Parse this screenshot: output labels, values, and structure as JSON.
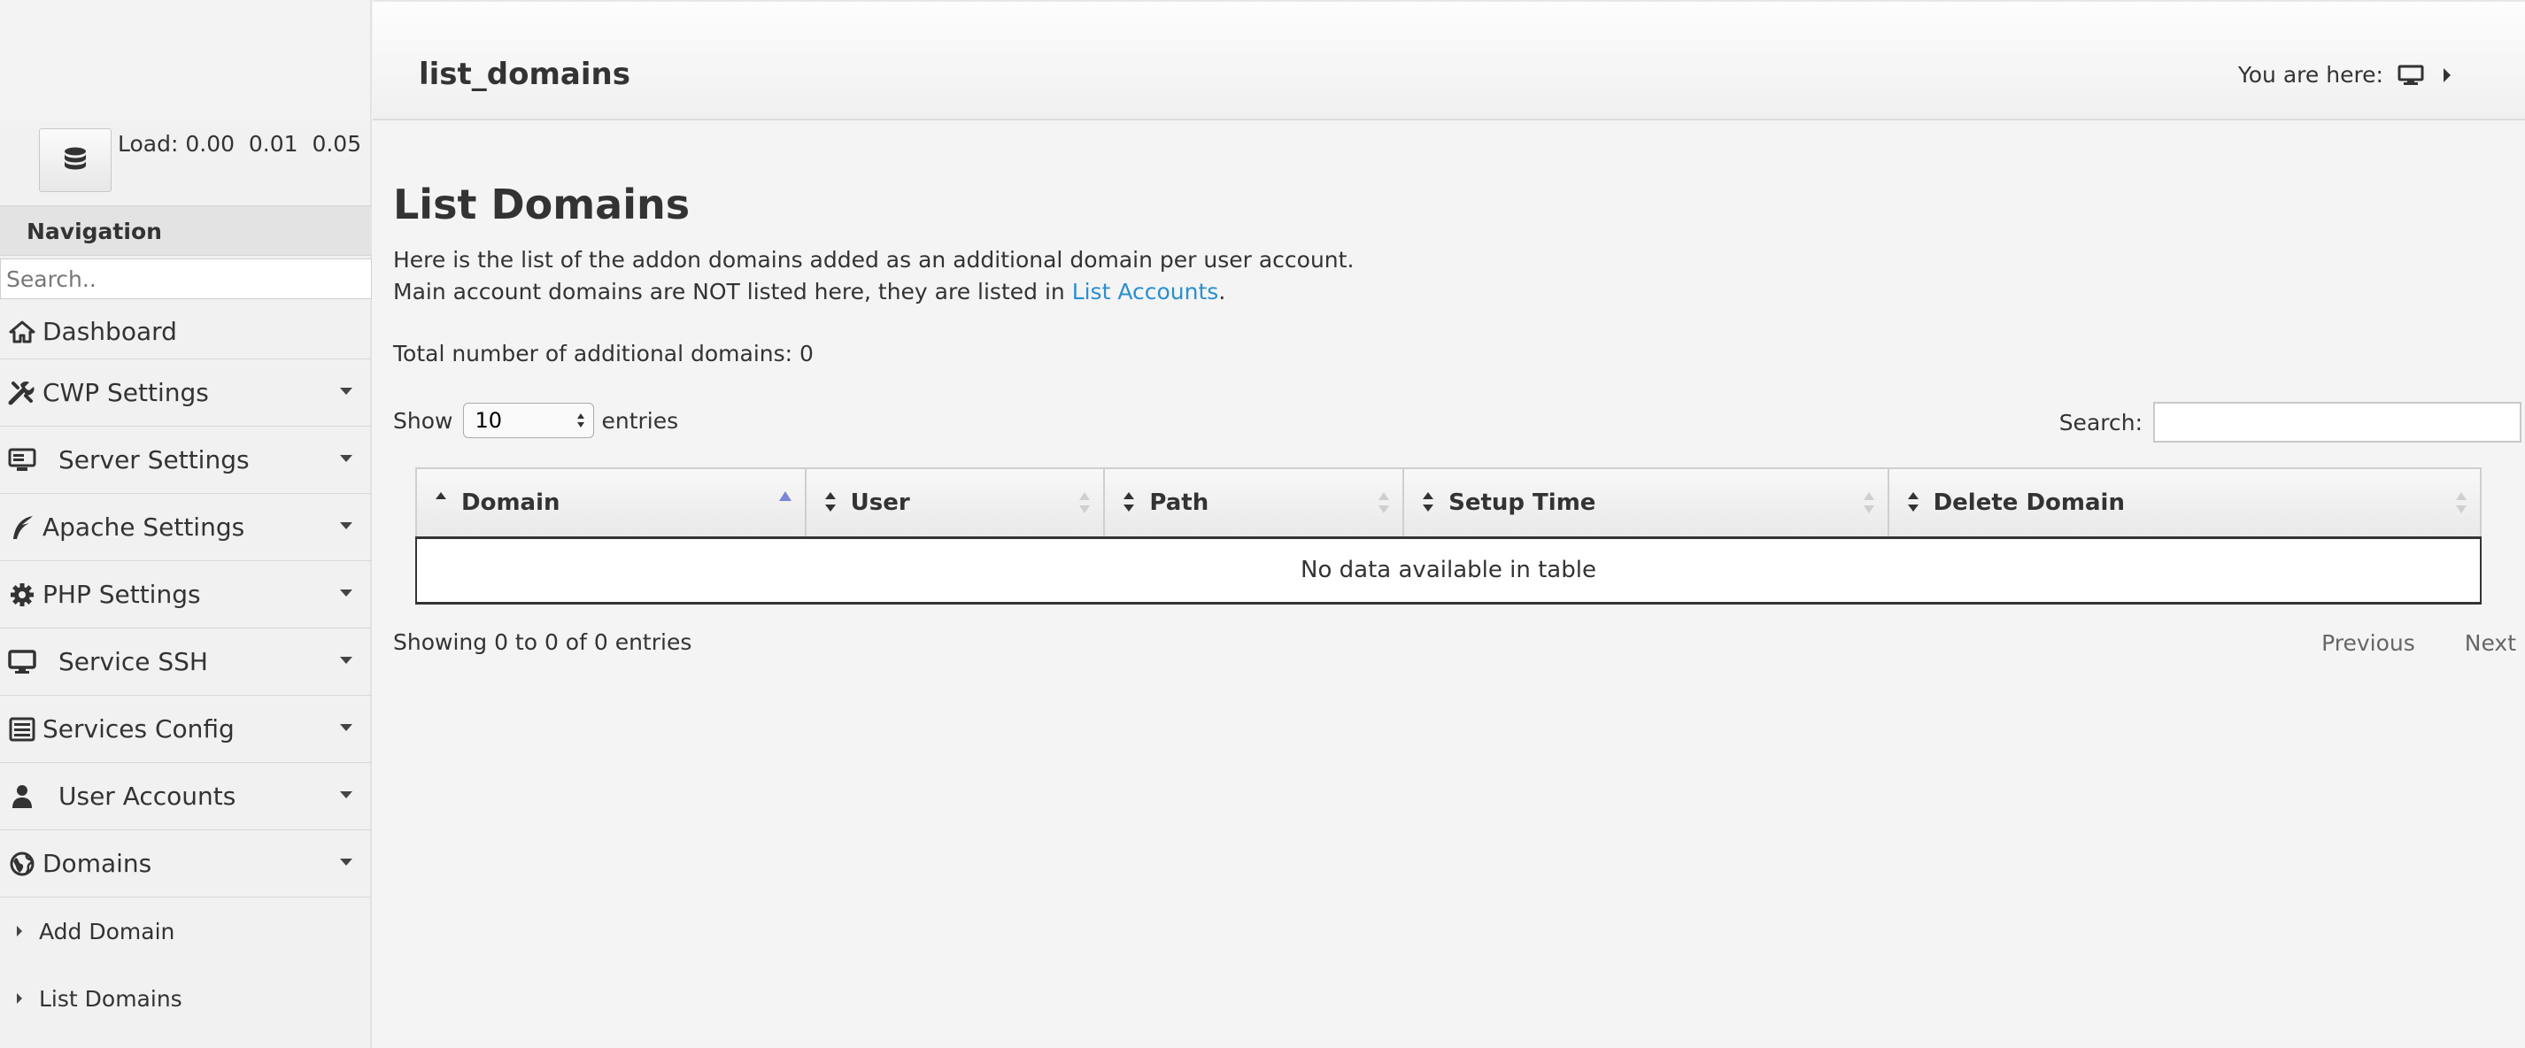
{
  "sidebar": {
    "load_label": "Load: 0.00  0.01  0.05",
    "nav_header": "Navigation",
    "search_placeholder": "Search..",
    "items": [
      {
        "label": "Dashboard",
        "icon": "home-icon"
      },
      {
        "label": "CWP Settings",
        "icon": "tools-icon"
      },
      {
        "label": "Server Settings",
        "icon": "server-icon"
      },
      {
        "label": "Apache Settings",
        "icon": "feather-icon"
      },
      {
        "label": "PHP Settings",
        "icon": "gear-icon"
      },
      {
        "label": "Service SSH",
        "icon": "monitor-icon"
      },
      {
        "label": "Services Config",
        "icon": "stack-icon"
      },
      {
        "label": "User Accounts",
        "icon": "user-icon"
      },
      {
        "label": "Domains",
        "icon": "globe-icon"
      }
    ],
    "sub_items": [
      {
        "label": "Add Domain"
      },
      {
        "label": "List Domains"
      }
    ]
  },
  "header": {
    "title": "list_domains",
    "breadcrumb_label": "You are here:"
  },
  "main": {
    "heading": "List Domains",
    "desc_line1": "Here is the list of the addon domains added as an additional domain per user account.",
    "desc_line2_prefix": "Main account domains are NOT listed here, they are listed in ",
    "desc_link": "List Accounts",
    "desc_line2_suffix": ".",
    "total": "Total number of additional domains: 0",
    "show_label": "Show",
    "show_value": "10",
    "entries_label": "entries",
    "search_label": "Search:",
    "columns": [
      "Domain",
      "User",
      "Path",
      "Setup Time",
      "Delete Domain"
    ],
    "empty_message": "No data available in table",
    "info": "Showing 0 to 0 of 0 entries",
    "prev_label": "Previous",
    "next_label": "Next"
  },
  "colors": {
    "link": "#2a8fd0",
    "sort_active": "#7b86d6"
  }
}
